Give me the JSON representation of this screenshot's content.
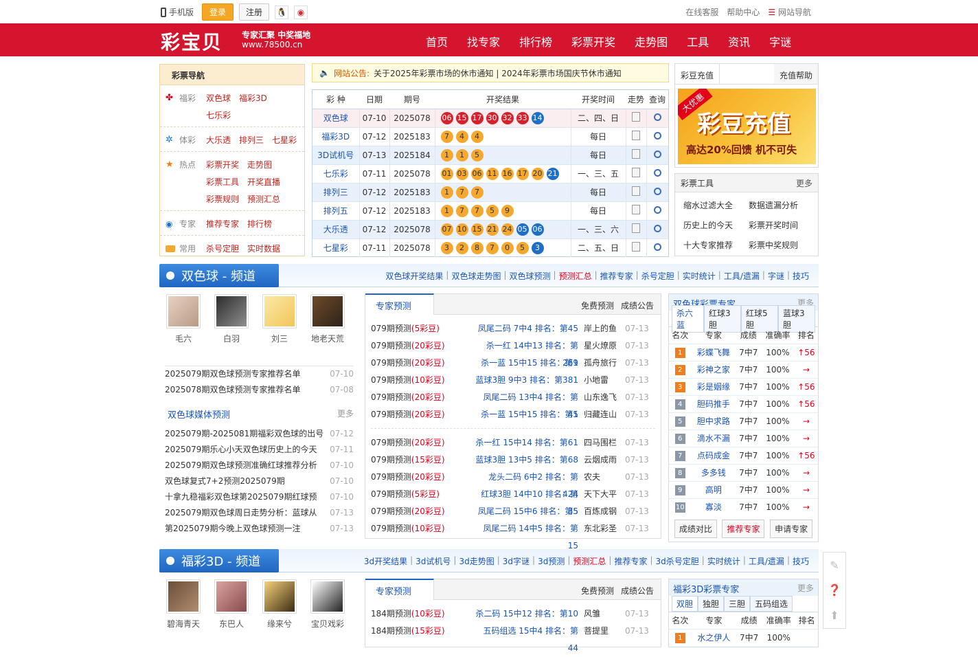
{
  "topbar": {
    "mobile": "手机版",
    "login": "登录",
    "register": "注册",
    "right": [
      "在线客服",
      "帮助中心",
      "网站导航"
    ]
  },
  "header": {
    "logo": "彩宝贝",
    "slogan": "专家汇聚 中奖福地",
    "domain": "www.78500.cn",
    "nav": [
      "首页",
      "找专家",
      "排行榜",
      "彩票开奖",
      "走势图",
      "工具",
      "资讯",
      "字谜"
    ]
  },
  "left_nav": {
    "title": "彩票导航",
    "groups": [
      {
        "cat": "福彩",
        "links": [
          "双色球",
          "福彩3D"
        ],
        "links2": [
          "七乐彩"
        ]
      },
      {
        "cat": "体彩",
        "links": [
          "大乐透",
          "排列三",
          "七星彩"
        ]
      },
      {
        "cat": "热点",
        "links": [
          "彩票开奖",
          "走势图"
        ],
        "links2": [
          "彩票工具",
          "开奖直播"
        ],
        "links3": [
          "彩票规则",
          "预测汇总"
        ]
      },
      {
        "cat": "专家",
        "links": [
          "推荐专家",
          "排行榜"
        ]
      },
      {
        "cat": "常用",
        "links": [
          "杀号定胆",
          "实时数据"
        ]
      }
    ]
  },
  "notice": {
    "label": "网站公告:",
    "text": "关于2025年彩票市场的休市通知 | 2024年彩票市场国庆节休市通知"
  },
  "draws": {
    "headers": [
      "彩 种",
      "日期",
      "期号",
      "开奖结果",
      "开奖时间",
      "走势",
      "查询"
    ],
    "rows": [
      {
        "name": "双色球",
        "date": "07-10",
        "issue": "2025078",
        "red": [
          "06",
          "15",
          "17",
          "30",
          "32",
          "33"
        ],
        "blue": [
          "14"
        ],
        "style": "red",
        "time": "二、四、日"
      },
      {
        "name": "福彩3D",
        "date": "07-12",
        "issue": "2025183",
        "red": [
          "7",
          "4",
          "4"
        ],
        "blue": [],
        "style": "yel",
        "time": "每日"
      },
      {
        "name": "3D试机号",
        "date": "07-13",
        "issue": "2025184",
        "red": [
          "1",
          "1",
          "5"
        ],
        "blue": [],
        "style": "yel",
        "time": "每日"
      },
      {
        "name": "七乐彩",
        "date": "07-11",
        "issue": "2025078",
        "red": [
          "01",
          "03",
          "06",
          "11",
          "16",
          "17",
          "20"
        ],
        "blue": [
          "21"
        ],
        "style": "yel",
        "time": "一、三、五"
      },
      {
        "name": "排列三",
        "date": "07-12",
        "issue": "2025183",
        "red": [
          "1",
          "7",
          "7"
        ],
        "blue": [],
        "style": "yel",
        "time": "每日"
      },
      {
        "name": "排列五",
        "date": "07-12",
        "issue": "2025183",
        "red": [
          "1",
          "7",
          "7",
          "5",
          "9"
        ],
        "blue": [],
        "style": "yel",
        "time": "每日"
      },
      {
        "name": "大乐透",
        "date": "07-12",
        "issue": "2025078",
        "red": [
          "07",
          "10",
          "15",
          "21",
          "24"
        ],
        "blue": [
          "05",
          "06"
        ],
        "style": "yel",
        "time": "一、三、六"
      },
      {
        "name": "七星彩",
        "date": "07-11",
        "issue": "2025078",
        "red": [
          "3",
          "2",
          "8",
          "7",
          "0",
          "5"
        ],
        "blue": [
          "3"
        ],
        "style": "yel",
        "time": "二、五、日"
      }
    ]
  },
  "recharge": {
    "tab1": "彩豆充值",
    "tab2": "充值帮助",
    "tag": "大优惠",
    "main": "彩豆充值",
    "sub": "高达20%回馈  机不可失"
  },
  "tools": {
    "title": "彩票工具",
    "more": "更多",
    "items": [
      "缩水过滤大全",
      "数据遗漏分析",
      "历史上的今天",
      "彩票开奖时间",
      "十大专家推荐",
      "彩票中奖规则"
    ]
  },
  "ssq": {
    "title": "双色球 - 频道",
    "links": [
      "双色球开奖结果",
      "双色球走势图",
      "双色球预测",
      "预测汇总",
      "推荐专家",
      "杀号定胆",
      "实时统计",
      "工具/遗漏",
      "字谜",
      "技巧"
    ],
    "experts": [
      "毛六",
      "白羽",
      "刘三",
      "地老天荒"
    ],
    "list1": [
      {
        "t": "2025079期双色球预测专家推荐名单",
        "d": "07-10"
      },
      {
        "t": "2025078期双色球预测专家推荐名单",
        "d": "07-08"
      }
    ],
    "media_title": "双色球媒体预测",
    "media_more": "更多",
    "list2": [
      {
        "t": "2025079期-2025081期福彩双色球的出号",
        "d": "07-12"
      },
      {
        "t": "2025079期乐心小天双色球历史上的今天",
        "d": "07-11"
      },
      {
        "t": "2025079期双色球预测准确红球推荐分析",
        "d": "07-10"
      },
      {
        "t": "双色球复式7+2预测2025079期",
        "d": "07-10"
      },
      {
        "t": "十拿九稳福彩双色球第2025079期红球预",
        "d": "07-10"
      },
      {
        "t": "2025079期双色球周日走势分析：蓝球从",
        "d": "07-13"
      },
      {
        "t": "第2025079期今晚上双色球预测一注",
        "d": "07-13"
      }
    ],
    "pred_tab": "专家预测",
    "pred_r1": "免费预测",
    "pred_r2": "成绩公告",
    "preds": [
      {
        "p": "079期预测",
        "c": "(5彩豆)",
        "m": "凤尾二码 7中4 排名：第45",
        "n": "岸上的鱼",
        "d": "07-13"
      },
      {
        "p": "079期预测",
        "c": "(20彩豆)",
        "m": "杀一红 14中13 排名：第269",
        "n": "星火燎原",
        "d": "07-13"
      },
      {
        "p": "079期预测",
        "c": "(20彩豆)",
        "m": "杀一蓝 15中15 排名：第1",
        "n": "孤舟旅行",
        "d": "07-13"
      },
      {
        "p": "079期预测",
        "c": "(10彩豆)",
        "m": "蓝球3胆 9中3 排名：第381",
        "n": "小地雷",
        "d": "07-13"
      },
      {
        "p": "079期预测",
        "c": "(20彩豆)",
        "m": "凤尾二码 13中4 排名：第45",
        "n": "山东逸飞",
        "d": "07-13"
      },
      {
        "p": "079期预测",
        "c": "(20彩豆)",
        "m": "杀一蓝 15中15 排名：第1",
        "n": "归藏连山",
        "d": "07-13"
      },
      {
        "p": "079期预测",
        "c": "(20彩豆)",
        "m": "杀一红 15中14 排名：第61",
        "n": "四马围栏",
        "d": "07-13"
      },
      {
        "p": "079期预测",
        "c": "(15彩豆)",
        "m": "蓝球3胆 13中5 排名：第68",
        "n": "云烟成雨",
        "d": "07-13"
      },
      {
        "p": "079期预测",
        "c": "(20彩豆)",
        "m": "龙头二码 6中2 排名：第424",
        "n": "农夫",
        "d": "07-13"
      },
      {
        "p": "079期预测",
        "c": "(5彩豆)",
        "m": "红球3胆 14中10 排名：第35",
        "n": "天下大平",
        "d": "07-13"
      },
      {
        "p": "079期预测",
        "c": "(20彩豆)",
        "m": "凤尾二码 15中6 排名：第5",
        "n": "百炼成钢",
        "d": "07-13"
      },
      {
        "p": "079期预测",
        "c": "(10彩豆)",
        "m": "凤尾二码 14中5 排名：第15",
        "n": "东北彩圣",
        "d": "07-13"
      }
    ],
    "rank_title": "双色球彩票专家",
    "rank_more": "更多",
    "rank_tabs": [
      "杀六蓝",
      "红球3胆",
      "红球5胆",
      "蓝球3胆"
    ],
    "rank_headers": [
      "名次",
      "专家",
      "成绩",
      "准确率",
      "排名"
    ],
    "rank_rows": [
      {
        "n": "1",
        "e": "彩蝶飞舞",
        "s": "7中7",
        "a": "100%",
        "r": "↑56"
      },
      {
        "n": "2",
        "e": "彩神之家",
        "s": "7中7",
        "a": "100%",
        "r": "→"
      },
      {
        "n": "3",
        "e": "彩是姻缘",
        "s": "7中7",
        "a": "100%",
        "r": "↑56"
      },
      {
        "n": "4",
        "e": "胆码推手",
        "s": "7中7",
        "a": "100%",
        "r": "↑56"
      },
      {
        "n": "5",
        "e": "胆中求路",
        "s": "7中7",
        "a": "100%",
        "r": "→"
      },
      {
        "n": "6",
        "e": "滴水不漏",
        "s": "7中7",
        "a": "100%",
        "r": "→"
      },
      {
        "n": "7",
        "e": "点码成金",
        "s": "7中7",
        "a": "100%",
        "r": "↑56"
      },
      {
        "n": "8",
        "e": "多多钱",
        "s": "7中7",
        "a": "100%",
        "r": "→"
      },
      {
        "n": "9",
        "e": "高明",
        "s": "7中7",
        "a": "100%",
        "r": "→"
      },
      {
        "n": "10",
        "e": "寡淡",
        "s": "7中7",
        "a": "100%",
        "r": "→"
      }
    ],
    "rank_btns": [
      "成绩对比",
      "推荐专家",
      "申请专家"
    ]
  },
  "fc3d": {
    "title": "福彩3D - 频道",
    "links": [
      "3d开奖结果",
      "3d试机号",
      "3d走势图",
      "3d字谜",
      "3d预测",
      "预测汇总",
      "推荐专家",
      "3d杀号定胆",
      "实时统计",
      "工具/遗漏",
      "技巧"
    ],
    "experts": [
      "碧海青天",
      "东巴人",
      "缘来兮",
      "宝贝戏彩"
    ],
    "pred_tab": "专家预测",
    "pred_r1": "免费预测",
    "pred_r2": "成绩公告",
    "preds": [
      {
        "p": "184期预测",
        "c": "(10彩豆)",
        "m": "杀二码 15中12 排名：第10",
        "n": "风雏",
        "d": "07-13"
      },
      {
        "p": "184期预测",
        "c": "(15彩豆)",
        "m": "五码组选 15中4 排名：第44",
        "n": "菩提里",
        "d": "07-13"
      }
    ],
    "rank_title": "福彩3D彩票专家",
    "rank_more": "更多",
    "rank_tabs": [
      "双胆",
      "独胆",
      "三胆",
      "五码组选"
    ],
    "rank_headers": [
      "名次",
      "专家",
      "成绩",
      "准确率",
      "排名"
    ],
    "rank_row": {
      "n": "1",
      "e": "水之伊人",
      "s": "7中7",
      "a": "100%"
    }
  }
}
